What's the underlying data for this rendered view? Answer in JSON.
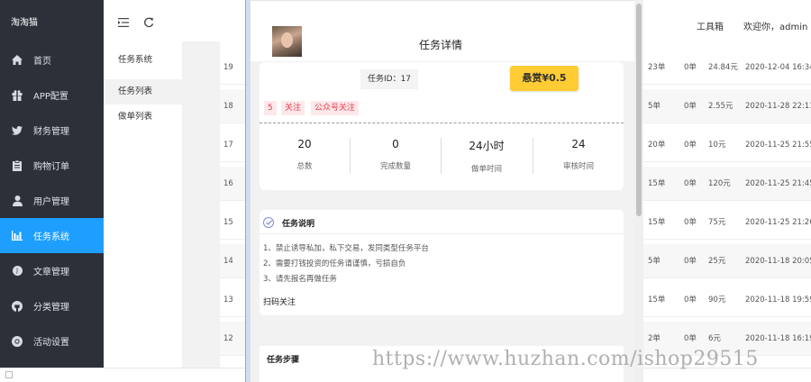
{
  "sidebar": {
    "brand": "淘淘猫",
    "items": [
      {
        "label": "首页",
        "icon": "home-icon"
      },
      {
        "label": "APP配置",
        "icon": "gift-icon"
      },
      {
        "label": "财务管理",
        "icon": "twitter-bird-icon"
      },
      {
        "label": "购物订单",
        "icon": "clipboard-icon"
      },
      {
        "label": "用户管理",
        "icon": "user-icon"
      },
      {
        "label": "任务系统",
        "icon": "bar-chart-icon",
        "active": true
      },
      {
        "label": "文章管理",
        "icon": "joomla-icon"
      },
      {
        "label": "分类管理",
        "icon": "github-icon"
      },
      {
        "label": "活动设置",
        "icon": "chrome-icon"
      }
    ]
  },
  "submenu": {
    "header": "任务系统",
    "items": [
      {
        "label": "任务列表",
        "selected": true
      },
      {
        "label": "做单列表",
        "selected": false
      }
    ]
  },
  "topbar": {
    "tools": "工具箱",
    "welcome": "欢迎你，admin"
  },
  "table": {
    "rows": [
      {
        "id": "19",
        "c1": "23单",
        "c2": "0单",
        "c3": "24.84元",
        "c4": "2020-12-04 16:34"
      },
      {
        "id": "18",
        "c1": "5单",
        "c2": "0单",
        "c3": "2.55元",
        "c4": "2020-11-28 22:11"
      },
      {
        "id": "17",
        "c1": "20单",
        "c2": "0单",
        "c3": "10元",
        "c4": "2020-11-25 21:55"
      },
      {
        "id": "16",
        "c1": "15单",
        "c2": "0单",
        "c3": "120元",
        "c4": "2020-11-25 21:45"
      },
      {
        "id": "15",
        "c1": "15单",
        "c2": "0单",
        "c3": "75元",
        "c4": "2020-11-25 21:26"
      },
      {
        "id": "14",
        "c1": "5单",
        "c2": "0单",
        "c3": "25元",
        "c4": "2020-11-18 20:05"
      },
      {
        "id": "13",
        "c1": "15单",
        "c2": "0单",
        "c3": "90元",
        "c4": "2020-11-18 19:59"
      },
      {
        "id": "12",
        "c1": "2单",
        "c2": "0单",
        "c3": "6元",
        "c4": "2020-11-18 16:19"
      }
    ]
  },
  "phone": {
    "title": "任务详情",
    "task_id": "任务ID：17",
    "reward": "悬赏¥0.5",
    "tags": [
      "5",
      "关注",
      "公众号关注"
    ],
    "stats": [
      {
        "value": "20",
        "label": "总数"
      },
      {
        "value": "0",
        "label": "完成数量"
      },
      {
        "value": "24小时",
        "label": "做单时间"
      },
      {
        "value": "24",
        "label": "审核时间"
      }
    ],
    "description_title": "任务说明",
    "rules": [
      "1、禁止诱导私加，私下交易，发同类型任务平台",
      "2、需要打钱投资的任务请谨慎，亏损自负",
      "3、请先报名再做任务"
    ],
    "scan_label": "扫码关注",
    "steps_title": "任务步骤"
  },
  "watermark": "https://www.huzhan.com/ishop29515"
}
